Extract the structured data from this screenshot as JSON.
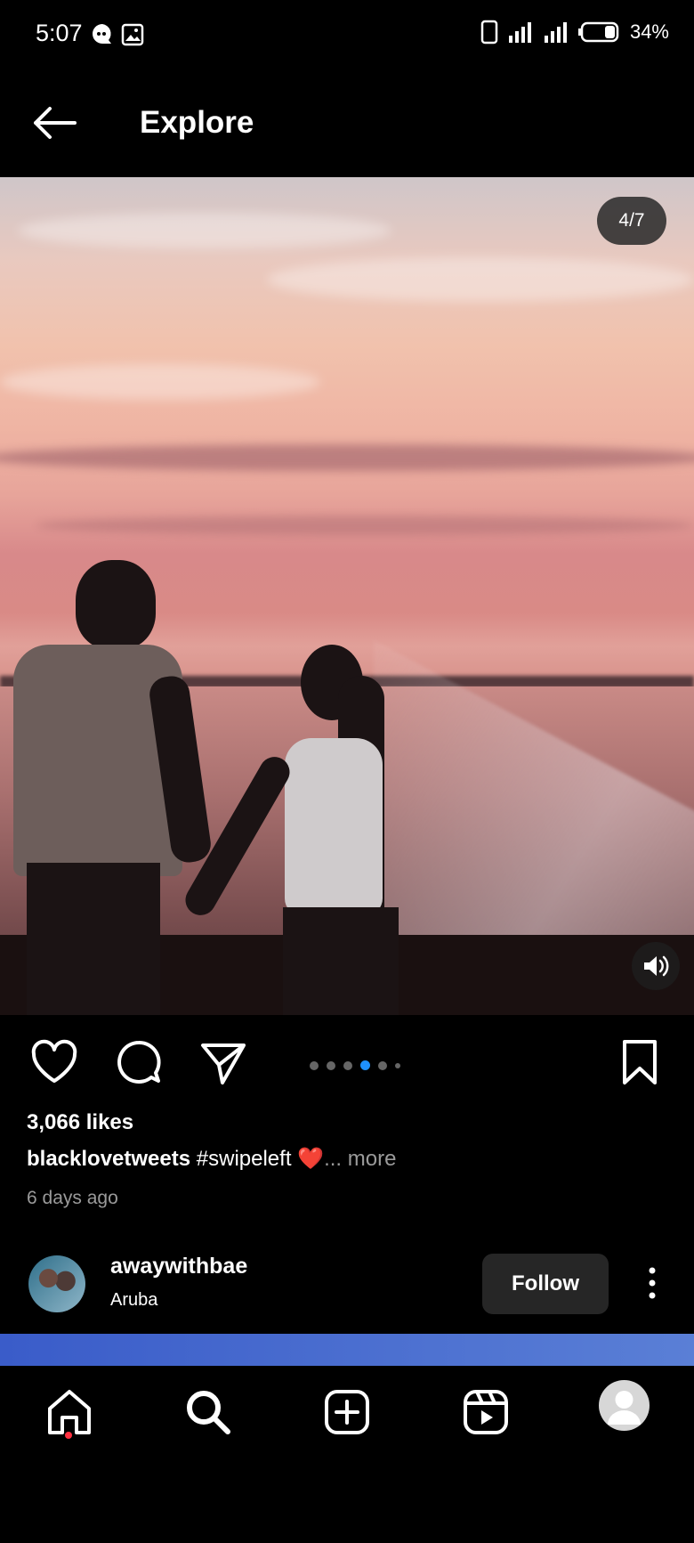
{
  "status_bar": {
    "time": "5:07",
    "battery": "34%"
  },
  "header": {
    "title": "Explore"
  },
  "post": {
    "media_counter": "4/7",
    "carousel": {
      "total_dots": 6,
      "active_index": 3
    },
    "likes": "3,066 likes",
    "caption_user": "blacklovetweets",
    "caption_text": "#swipeleft",
    "caption_emoji": "❤️",
    "caption_more": "... more",
    "time_ago": "6 days ago"
  },
  "next_post": {
    "username": "awaywithbae",
    "location": "Aruba",
    "follow_label": "Follow"
  },
  "colors": {
    "background": "#000000",
    "active_dot": "#1e90ff",
    "follow_button": "#262626",
    "notification_dot": "#ff3040"
  },
  "icons": {
    "header": [
      "back-arrow-icon"
    ],
    "actions": [
      "heart-icon",
      "comment-icon",
      "share-icon",
      "bookmark-icon"
    ],
    "nav": [
      "home-icon",
      "search-icon",
      "create-icon",
      "reels-icon",
      "profile-icon"
    ]
  }
}
